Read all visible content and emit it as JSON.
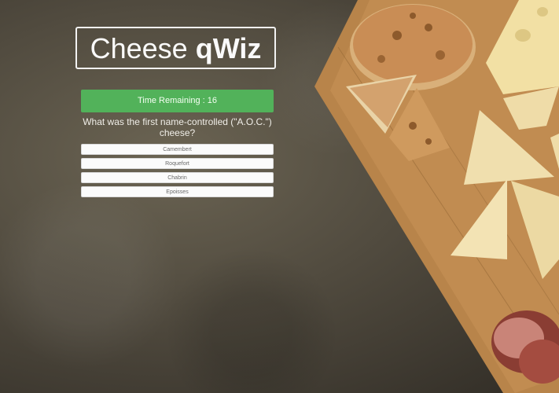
{
  "app": {
    "title_part1": "Cheese",
    "title_part2": "qWiz"
  },
  "timer": {
    "label": "Time Remaining : 16"
  },
  "question": {
    "text": "What was the first name-controlled (\"A.O.C.\") cheese?"
  },
  "answers": [
    {
      "label": "Camembert"
    },
    {
      "label": "Roquefort"
    },
    {
      "label": "Chabrin"
    },
    {
      "label": "Epoisses"
    }
  ],
  "colors": {
    "timer_bar": "#52b25a",
    "background": "#514b3f",
    "board": "#b8844a"
  }
}
